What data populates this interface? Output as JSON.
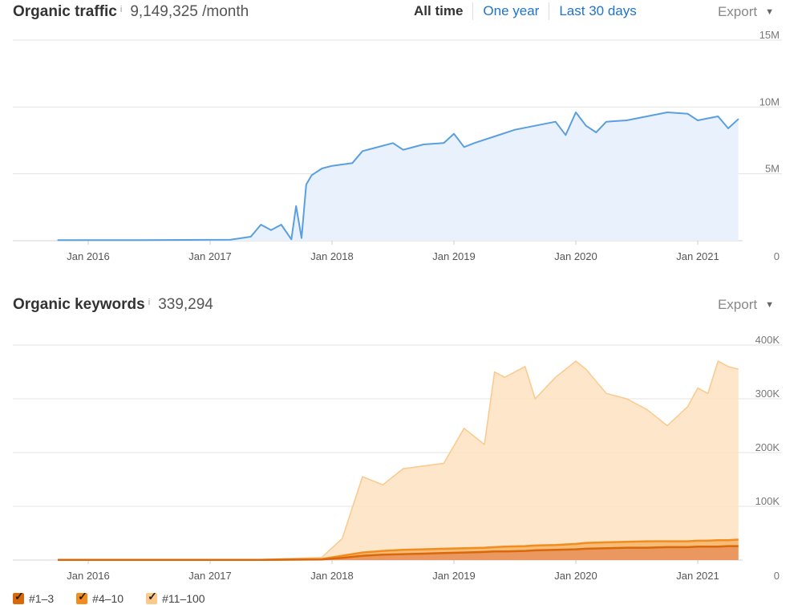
{
  "traffic": {
    "title": "Organic traffic",
    "info": "i",
    "value": "9,149,325 /month",
    "tabs": [
      {
        "label": "All time",
        "active": true
      },
      {
        "label": "One year",
        "active": false
      },
      {
        "label": "Last 30 days",
        "active": false
      }
    ],
    "export_label": "Export"
  },
  "keywords": {
    "title": "Organic keywords",
    "info": "i",
    "value": "339,294",
    "export_label": "Export"
  },
  "legend": [
    {
      "label": "#1–3",
      "color": "#d9680a"
    },
    {
      "label": "#4–10",
      "color": "#f28c1e"
    },
    {
      "label": "#11–100",
      "color": "#fbc98c"
    }
  ],
  "chart_data": [
    {
      "type": "area",
      "title": "Organic traffic",
      "x_ticks": [
        "Jan 2016",
        "Jan 2017",
        "Jan 2018",
        "Jan 2019",
        "Jan 2020",
        "Jan 2021"
      ],
      "y_ticks": [
        "0",
        "5M",
        "10M",
        "15M"
      ],
      "ylim": [
        0,
        15000000
      ],
      "color": "#5a9fe0",
      "series": [
        {
          "x": [
            "2015-10",
            "2016-06",
            "2017-03",
            "2017-05",
            "2017-06",
            "2017-07",
            "2017-08",
            "2017-09",
            "2017-09-15",
            "2017-10",
            "2017-10-15",
            "2017-11",
            "2017-12",
            "2018-01",
            "2018-03",
            "2018-04",
            "2018-05",
            "2018-07",
            "2018-08",
            "2018-10",
            "2018-12",
            "2019-01",
            "2019-02",
            "2019-03",
            "2019-05",
            "2019-07",
            "2019-09",
            "2019-11",
            "2019-12",
            "2020-01",
            "2020-02",
            "2020-03",
            "2020-04",
            "2020-06",
            "2020-08",
            "2020-10",
            "2020-12",
            "2021-01",
            "2021-03",
            "2021-04",
            "2021-05"
          ],
          "values": [
            50000,
            50000,
            80000,
            300000,
            1200000,
            800000,
            1200000,
            100000,
            2600000,
            200000,
            4200000,
            4900000,
            5400000,
            5600000,
            5800000,
            6700000,
            6900000,
            7300000,
            6800000,
            7200000,
            7300000,
            8000000,
            7000000,
            7300000,
            7800000,
            8300000,
            8600000,
            8900000,
            7900000,
            9600000,
            8600000,
            8100000,
            8900000,
            9000000,
            9300000,
            9600000,
            9500000,
            9000000,
            9300000,
            8400000,
            9100000
          ]
        }
      ]
    },
    {
      "type": "area",
      "title": "Organic keywords",
      "x_ticks": [
        "Jan 2016",
        "Jan 2017",
        "Jan 2018",
        "Jan 2019",
        "Jan 2020",
        "Jan 2021"
      ],
      "y_ticks": [
        "0",
        "100K",
        "200K",
        "300K",
        "400K"
      ],
      "ylim": [
        0,
        400000
      ],
      "x": [
        "2015-10",
        "2017-06",
        "2017-12",
        "2018-02",
        "2018-04",
        "2018-06",
        "2018-08",
        "2018-10",
        "2018-12",
        "2019-02",
        "2019-04",
        "2019-05",
        "2019-06",
        "2019-08",
        "2019-09",
        "2019-11",
        "2020-01",
        "2020-02",
        "2020-04",
        "2020-06",
        "2020-08",
        "2020-10",
        "2020-12",
        "2021-01",
        "2021-02",
        "2021-03",
        "2021-04",
        "2021-05"
      ],
      "series": [
        {
          "name": "#11–100",
          "color": "#fbc98c",
          "values": [
            1000,
            1000,
            5000,
            40000,
            155000,
            140000,
            170000,
            175000,
            180000,
            245000,
            215000,
            350000,
            340000,
            360000,
            300000,
            340000,
            370000,
            355000,
            310000,
            300000,
            280000,
            250000,
            285000,
            320000,
            310000,
            370000,
            360000,
            355000
          ]
        },
        {
          "name": "#4–10",
          "color": "#f28c1e",
          "values": [
            500,
            500,
            2000,
            8000,
            14000,
            17000,
            19000,
            20000,
            21000,
            22000,
            23000,
            24000,
            25000,
            26000,
            27000,
            28000,
            30000,
            32000,
            33000,
            34000,
            35000,
            35000,
            35000,
            36000,
            36000,
            37000,
            37000,
            38000
          ]
        },
        {
          "name": "#1–3",
          "color": "#d9680a",
          "values": [
            300,
            300,
            1000,
            4000,
            8000,
            10000,
            11000,
            12000,
            13000,
            14000,
            15000,
            16000,
            16000,
            17000,
            18000,
            19000,
            20000,
            21000,
            22000,
            23000,
            23000,
            24000,
            24000,
            25000,
            25000,
            25000,
            26000,
            26000
          ]
        }
      ]
    }
  ]
}
